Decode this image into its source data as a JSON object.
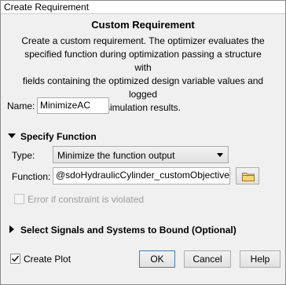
{
  "window": {
    "title": "Create Requirement"
  },
  "header": {
    "title": "Custom Requirement",
    "description_lines": [
      "Create a custom requirement. The optimizer evaluates the",
      "specified function during optimization passing a structure with",
      "fields containing the optimized design variable values and logged",
      "simulation results."
    ]
  },
  "name": {
    "label": "Name:",
    "value": "MinimizeAC"
  },
  "specify_function": {
    "header": "Specify Function",
    "type_label": "Type:",
    "type_value": "Minimize the function output",
    "function_label": "Function:",
    "function_value": "@sdoHydraulicCylinder_customObjective",
    "error_checkbox_label": "Error if constraint is violated",
    "error_checkbox_checked": false,
    "error_checkbox_enabled": false
  },
  "signals": {
    "header": "Select Signals and Systems to Bound (Optional)"
  },
  "footer": {
    "create_plot_label": "Create Plot",
    "create_plot_checked": true,
    "ok_label": "OK",
    "cancel_label": "Cancel",
    "help_label": "Help"
  }
}
